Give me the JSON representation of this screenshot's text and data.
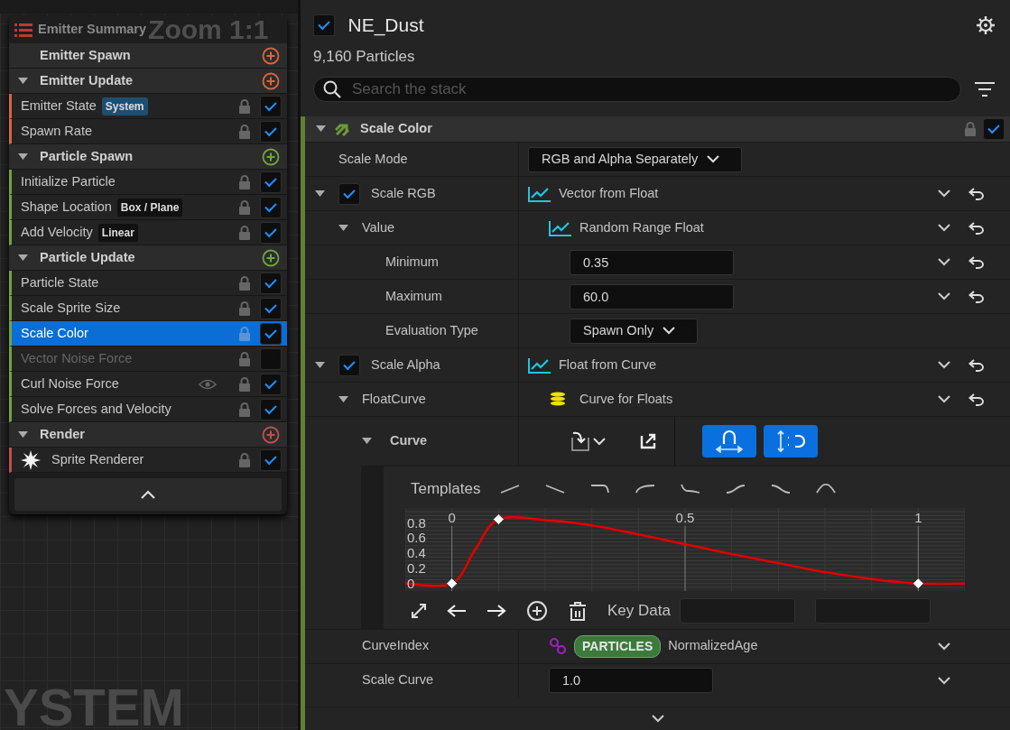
{
  "graph_overlay": {
    "zoom_label": "Zoom 1:1",
    "watermark": "YSTEM"
  },
  "summary": {
    "title": "Emitter Summary",
    "sections": [
      {
        "label": "Emitter Spawn",
        "caret": false,
        "color": "#d9653b"
      },
      {
        "label": "Emitter Update",
        "caret": true,
        "color": "#d9653b",
        "modules": [
          {
            "label": "Emitter State",
            "kind": "module",
            "tag": {
              "label": "System",
              "kind": "scope"
            },
            "checked": true,
            "selected": false,
            "disabled": false,
            "eye": false
          },
          {
            "label": "Spawn Rate",
            "kind": "module",
            "checked": true,
            "selected": false,
            "disabled": false,
            "eye": false
          }
        ]
      },
      {
        "label": "Particle Spawn",
        "caret": true,
        "color": "#6fa63a",
        "modules": [
          {
            "label": "Initialize Particle",
            "kind": "module",
            "checked": true,
            "selected": false,
            "disabled": false,
            "eye": false
          },
          {
            "label": "Shape Location",
            "kind": "module",
            "tag": {
              "label": "Box / Plane",
              "kind": "mode"
            },
            "checked": true,
            "selected": false,
            "disabled": false,
            "eye": false
          },
          {
            "label": "Add Velocity",
            "kind": "module",
            "tag": {
              "label": "Linear",
              "kind": "mode"
            },
            "checked": true,
            "selected": false,
            "disabled": false,
            "eye": false
          }
        ]
      },
      {
        "label": "Particle Update",
        "caret": true,
        "color": "#6fa63a",
        "modules": [
          {
            "label": "Particle State",
            "kind": "module",
            "checked": true,
            "selected": false,
            "disabled": false,
            "eye": false
          },
          {
            "label": "Scale Sprite Size",
            "kind": "module",
            "checked": true,
            "selected": false,
            "disabled": false,
            "eye": false
          },
          {
            "label": "Scale Color",
            "kind": "module",
            "checked": true,
            "selected": true,
            "disabled": false,
            "eye": false
          },
          {
            "label": "Vector Noise Force",
            "kind": "module",
            "checked": false,
            "selected": false,
            "disabled": true,
            "eye": false
          },
          {
            "label": "Curl Noise Force",
            "kind": "module",
            "checked": true,
            "selected": false,
            "disabled": false,
            "eye": true
          },
          {
            "label": "Solve Forces and Velocity",
            "kind": "module",
            "checked": true,
            "selected": false,
            "disabled": false,
            "eye": false
          }
        ]
      },
      {
        "label": "Render",
        "caret": true,
        "color": "#c0504d",
        "modules": [
          {
            "label": "Sprite Renderer",
            "kind": "renderer",
            "checked": true,
            "selected": false,
            "disabled": false,
            "eye": false
          }
        ]
      }
    ]
  },
  "emitter": {
    "enabled": true,
    "name": "NE_Dust",
    "count": "9,160 Particles"
  },
  "search": {
    "placeholder": "Search the stack"
  },
  "stack": {
    "module": {
      "label": "Scale Color",
      "expanded": true,
      "checked": true,
      "rows": [
        {
          "label": "Scale Mode",
          "value": {
            "kind": "enum",
            "text": "RGB and Alpha Separately"
          }
        },
        {
          "label": "Scale RGB",
          "checked": true,
          "expanded": true,
          "reset": true,
          "value": {
            "kind": "dynamic",
            "text": "Vector from Float"
          },
          "children": [
            {
              "label": "Value",
              "expanded": true,
              "reset": true,
              "value": {
                "kind": "dynamic",
                "text": "Random Range Float"
              },
              "children": [
                {
                  "label": "Minimum",
                  "reset": true,
                  "value": {
                    "kind": "float",
                    "text": "0.35"
                  }
                },
                {
                  "label": "Maximum",
                  "reset": true,
                  "value": {
                    "kind": "float",
                    "text": "60.0"
                  }
                },
                {
                  "label": "Evaluation Type",
                  "value": {
                    "kind": "enum",
                    "text": "Spawn Only"
                  }
                }
              ]
            }
          ]
        },
        {
          "label": "Scale Alpha",
          "checked": true,
          "expanded": true,
          "reset": true,
          "value": {
            "kind": "dynamic",
            "text": "Float from Curve"
          },
          "children": [
            {
              "label": "FloatCurve",
              "expanded": true,
              "reset": true,
              "value": {
                "kind": "data-interface",
                "text": "Curve for Floats"
              },
              "children": [
                {
                  "label": "Curve",
                  "expanded": true,
                  "value": {
                    "kind": "curve-toolbar",
                    "toggles": [
                      {
                        "on": true
                      },
                      {
                        "on": true
                      }
                    ]
                  },
                  "editor": {
                    "templates_label": "Templates",
                    "key_data_label": "Key Data",
                    "chart_data": {
                      "type": "line",
                      "x": [
                        -0.1,
                        0,
                        0.05,
                        0.1,
                        0.2,
                        0.3,
                        0.4,
                        0.5,
                        0.6,
                        0.7,
                        0.8,
                        0.9,
                        1,
                        1.1
                      ],
                      "series": [
                        {
                          "color": "#e00000",
                          "values": [
                            0,
                            0,
                            0.45,
                            0.85,
                            0.84,
                            0.77,
                            0.65,
                            0.52,
                            0.39,
                            0.27,
                            0.15,
                            0.06,
                            0,
                            0
                          ]
                        }
                      ],
                      "xlim": [
                        -0.1,
                        1.1
                      ],
                      "ylim": [
                        -0.1,
                        1.0
                      ],
                      "xticks": [
                        0,
                        0.5,
                        1
                      ],
                      "yticks": [
                        0,
                        0.2,
                        0.4,
                        0.6,
                        0.8
                      ],
                      "grid": true
                    }
                  }
                }
              ]
            },
            {
              "label": "CurveIndex",
              "reset": false,
              "value": {
                "kind": "binding",
                "namespace": "PARTICLES",
                "text": "NormalizedAge"
              }
            },
            {
              "label": "Scale Curve",
              "reset": false,
              "value": {
                "kind": "float",
                "text": "1.0"
              }
            }
          ]
        }
      ]
    }
  }
}
